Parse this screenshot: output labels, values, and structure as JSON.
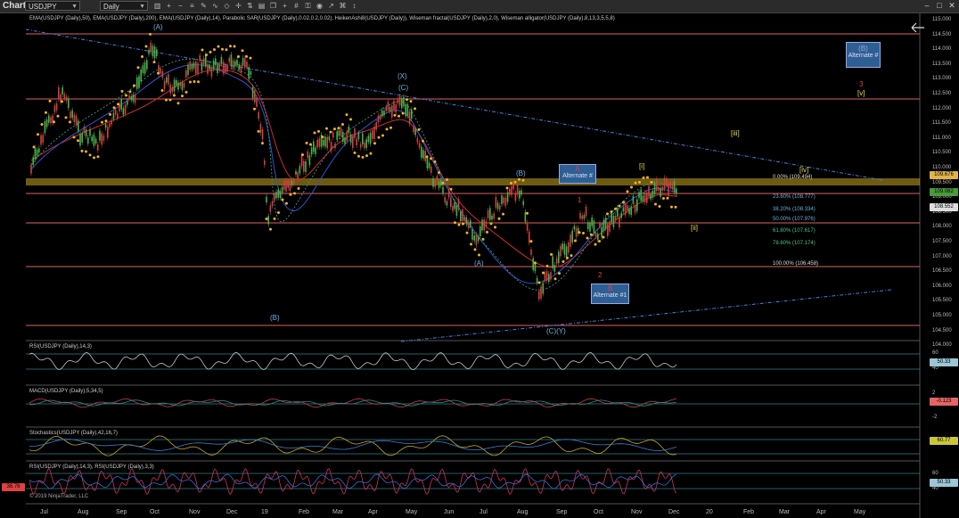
{
  "toolbar": {
    "title": "Chart",
    "instrument": "USDJPY",
    "interval": "Daily",
    "icons": [
      "bar-chart-icon",
      "zoom-in-icon",
      "zoom-out-icon",
      "properties-icon",
      "drawing-tools-icon",
      "indicators-icon",
      "strategies-icon",
      "crosshair-icon",
      "chart-trader-icon",
      "data-box-icon",
      "templates-icon",
      "plus-icon",
      "grid-icon",
      "lock-icon",
      "screenshot-icon",
      "share-icon",
      "attach-icon",
      "arrow-icon"
    ],
    "window_buttons": [
      "minimize-icon",
      "maximize-icon",
      "close-icon"
    ]
  },
  "indicator_labels": {
    "main": "EMA(USDJPY (Daily),50), EMA(USDJPY (Daily),200), EMA(USDJPY (Daily),14), Parabolic SAR(USDJPY (Daily),0.02,0.2,0.02), HeikenAshi8(USDJPY (Daily)), Wiseman fractal(USDJPY (Daily),2,0), Wiseman alligator(USDJPY (Daily),8,13,3,5,5,8)",
    "rsi": "RSI(USDJPY (Daily),14,3)",
    "macd": "MACD(USDJPY (Daily),5,34,5)",
    "stoch": "Stochastics(USDJPY (Daily),42,16,7)",
    "rsi2": "RSI(USDJPY (Daily),14,3), RSI(USDJPY (Daily),3,3)"
  },
  "price_axis": [
    "115.000",
    "114.500",
    "114.000",
    "113.500",
    "113.000",
    "112.500",
    "112.000",
    "111.500",
    "111.000",
    "110.500",
    "110.000",
    "109.500",
    "109.000",
    "108.500",
    "108.000",
    "107.500",
    "107.000",
    "106.500",
    "106.000",
    "105.500",
    "105.000",
    "104.500",
    "104.000"
  ],
  "price_boxes": {
    "top": "109.676",
    "mid": "109.082",
    "low": "108.552"
  },
  "rsi_axis": [
    "60",
    "40"
  ],
  "rsi_box": "50.33",
  "macd_axis": [
    "2",
    "0",
    "-2"
  ],
  "macd_box": "-0.123",
  "stoch_box": "60.77",
  "rsi2_axis": [
    "60",
    "40"
  ],
  "rsi2_boxes": {
    "right": "50.33",
    "left": "36.76"
  },
  "time_axis": [
    "Jul",
    "Aug",
    "Sep",
    "Oct",
    "Nov",
    "Dec",
    "19",
    "Feb",
    "Mar",
    "Apr",
    "May",
    "Jun",
    "Jul",
    "Aug",
    "Sep",
    "Oct",
    "Nov",
    "Dec",
    "20",
    "Feb",
    "Mar",
    "Apr",
    "May"
  ],
  "wave_labels": {
    "a_top": "(A)",
    "x_label": "(X)",
    "c_label": "(C)",
    "b_low": "(B)",
    "b_mid": "(B)",
    "a_mid": "(A)",
    "cy_low": "(C)(Y)",
    "i_label": "[i]",
    "ii_label": "[ii]",
    "iii_label": "[iii]",
    "iv_label": "[iv]",
    "v_label": "[v]",
    "three_label": "3",
    "one_label": "1",
    "two_label": "2",
    "a_alt": "A",
    "b_alt": "B"
  },
  "alt_boxes": {
    "top_right": {
      "wave": "(B)",
      "text": "Alternate #"
    },
    "a_box": {
      "text": "Alternate #"
    },
    "b_box": {
      "text": "Alternate #1"
    }
  },
  "fib_levels": [
    "0.00% (109.494)",
    "23.60% (108.777)",
    "38.20% (108.334)",
    "50.00% (107.976)",
    "61.80% (107.617)",
    "78.60% (107.174)",
    "100.00% (106.458)"
  ],
  "copyright": "© 2019 NinjaTrader, LLC"
}
